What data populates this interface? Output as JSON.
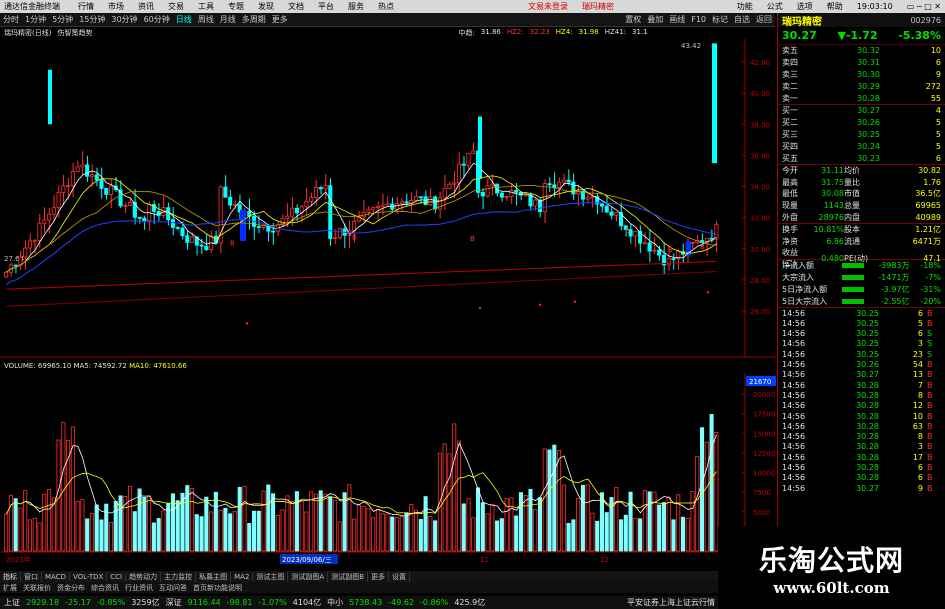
{
  "window": {
    "title": "通达信金融终端",
    "menus": [
      "行情",
      "市场",
      "资讯",
      "交易",
      "工具",
      "专题",
      "发现",
      "文档",
      "平台",
      "服务",
      "热点"
    ],
    "right_menus": [
      "文易未登录",
      "瑞玛精密"
    ],
    "right_tools": [
      "功能",
      "公式",
      "选项",
      "帮助"
    ],
    "clock": "19:03:10"
  },
  "toolbar": {
    "periods": [
      "分时",
      "1分钟",
      "5分钟",
      "15分钟",
      "30分钟",
      "60分钟",
      "日线",
      "周线",
      "月线",
      "多周期",
      "更多"
    ],
    "active_period": "日线",
    "right_items": [
      "置权",
      "叠加",
      "画线",
      "F10",
      "标记",
      "自选",
      "返回"
    ]
  },
  "chart_header": {
    "stock": "瑞玛精密(日线)",
    "indicator": "伤智策趋势",
    "items": [
      {
        "label": "中趋:",
        "value": "31.86"
      },
      {
        "label": "HZ2:",
        "value": "32.23"
      },
      {
        "label": "HZ4:",
        "value": "31.98"
      },
      {
        "label": "HZ41:",
        "value": "31.1"
      }
    ]
  },
  "price_axis": [
    "42.00",
    "40.00",
    "38.00",
    "36.00",
    "34.00",
    "32.00",
    "30.00",
    "28.00",
    "26.00"
  ],
  "price_max_label": "43.42",
  "price_min_label": "27.64",
  "volume_header": {
    "label": "VOLUME:",
    "value": "69965.10",
    "ma5_label": "MA5:",
    "ma5": "74592.72",
    "ma10_label": "MA10:",
    "ma10": "47610.66"
  },
  "volume_axis": [
    "20000",
    "17500",
    "15000",
    "12500",
    "10000",
    "7500",
    "5000",
    "2500"
  ],
  "volume_top": "21670",
  "date_labels": [
    "2023年",
    "2023/09/06/三",
    "11",
    "12"
  ],
  "side": {
    "name": "瑞玛精密",
    "code": "002976",
    "price": "30.27",
    "change": "▼-1.72",
    "change_pct": "-5.38%",
    "asks": [
      {
        "label": "卖五",
        "price": "30.32",
        "vol": "10"
      },
      {
        "label": "卖四",
        "price": "30.31",
        "vol": "6"
      },
      {
        "label": "卖三",
        "price": "30.30",
        "vol": "9"
      },
      {
        "label": "卖二",
        "price": "30.29",
        "vol": "272"
      },
      {
        "label": "卖一",
        "price": "30.28",
        "vol": "55"
      }
    ],
    "bids": [
      {
        "label": "买一",
        "price": "30.27",
        "vol": "4"
      },
      {
        "label": "买二",
        "price": "30.26",
        "vol": "5"
      },
      {
        "label": "买三",
        "price": "30.25",
        "vol": "5"
      },
      {
        "label": "买四",
        "price": "30.24",
        "vol": "5"
      },
      {
        "label": "买五",
        "price": "30.23",
        "vol": "6"
      }
    ],
    "info": [
      {
        "l1": "今开",
        "v1": "31.11",
        "l2": "均价",
        "v2": "30.82"
      },
      {
        "l1": "最高",
        "v1": "31.75",
        "l2": "量比",
        "v2": "1.76"
      },
      {
        "l1": "最低",
        "v1": "30.08",
        "l2": "市值",
        "v2": "36.5亿"
      },
      {
        "l1": "现量",
        "v1": "1143",
        "l2": "总量",
        "v2": "69965"
      },
      {
        "l1": "外盘",
        "v1": "28976",
        "l2": "内盘",
        "v2": "40989"
      }
    ],
    "info2": [
      {
        "l1": "换手",
        "v1": "10.81%",
        "l2": "股本",
        "v2": "1.21亿"
      },
      {
        "l1": "净资",
        "v1": "6.86",
        "l2": "流通",
        "v2": "6471万"
      },
      {
        "l1": "收益(二)",
        "v1": "0.480",
        "l2": "PE(动)",
        "v2": "47.1"
      }
    ],
    "flows": [
      {
        "label": "净流入额",
        "value": "-3983万",
        "pct": "-18%"
      },
      {
        "label": "大宗流入",
        "value": "-1471万",
        "pct": "-7%"
      },
      {
        "label": "5日净流入额",
        "value": "-3.97亿",
        "pct": "-31%"
      },
      {
        "label": "5日大宗流入",
        "value": "-2.55亿",
        "pct": "-20%"
      }
    ],
    "ticks": [
      {
        "t": "14:56",
        "p": "30.25",
        "v": "6",
        "d": "B"
      },
      {
        "t": "14:56",
        "p": "30.25",
        "v": "5",
        "d": "B"
      },
      {
        "t": "14:56",
        "p": "30.25",
        "v": "6",
        "d": "S"
      },
      {
        "t": "14:56",
        "p": "30.25",
        "v": "3",
        "d": "S"
      },
      {
        "t": "14:56",
        "p": "30.25",
        "v": "23",
        "d": "S"
      },
      {
        "t": "14:56",
        "p": "30.26",
        "v": "54",
        "d": "B"
      },
      {
        "t": "14:56",
        "p": "30.27",
        "v": "13",
        "d": "B"
      },
      {
        "t": "14:56",
        "p": "30.28",
        "v": "7",
        "d": "B"
      },
      {
        "t": "14:56",
        "p": "30.28",
        "v": "8",
        "d": "B"
      },
      {
        "t": "14:56",
        "p": "30.28",
        "v": "12",
        "d": "B"
      },
      {
        "t": "14:56",
        "p": "30.28",
        "v": "10",
        "d": "B"
      },
      {
        "t": "14:56",
        "p": "30.28",
        "v": "63",
        "d": "B"
      },
      {
        "t": "14:56",
        "p": "30.28",
        "v": "8",
        "d": "B"
      },
      {
        "t": "14:56",
        "p": "30.28",
        "v": "3",
        "d": "B"
      },
      {
        "t": "14:56",
        "p": "30.28",
        "v": "17",
        "d": "B"
      },
      {
        "t": "14:56",
        "p": "30.28",
        "v": "6",
        "d": "B"
      },
      {
        "t": "14:56",
        "p": "30.28",
        "v": "6",
        "d": "B"
      },
      {
        "t": "14:56",
        "p": "30.27",
        "v": "9",
        "d": "B"
      }
    ]
  },
  "bottom_tabs": [
    "指标",
    "窗口",
    "MACD",
    "VOL-TDX",
    "CCI",
    "趋势动力",
    "主力监控",
    "私募主图",
    "MA2",
    "测试主图",
    "测试副图A",
    "测试副图B",
    "更多",
    "设置"
  ],
  "bottom_tabs2": [
    "扩展",
    "关联报价",
    "资金分布",
    "综合资讯",
    "行业资讯",
    "互动问答",
    "首页新功能说明"
  ],
  "status": [
    {
      "label": "上证",
      "value": "2929.18",
      "chg": "-25.17",
      "pct": "-0.85%",
      "amt": "3259亿"
    },
    {
      "label": "深证",
      "value": "9116.44",
      "chg": "-98.81",
      "pct": "-1.07%",
      "amt": "4104亿"
    },
    {
      "label": "中小",
      "value": "5738.43",
      "chg": "-49.62",
      "pct": "-0.86%",
      "amt": "425.9亿"
    }
  ],
  "status_right": "平安证券上海上证云行情",
  "watermark": {
    "title": "乐淘公式网",
    "url": "www.60lt.com"
  }
}
